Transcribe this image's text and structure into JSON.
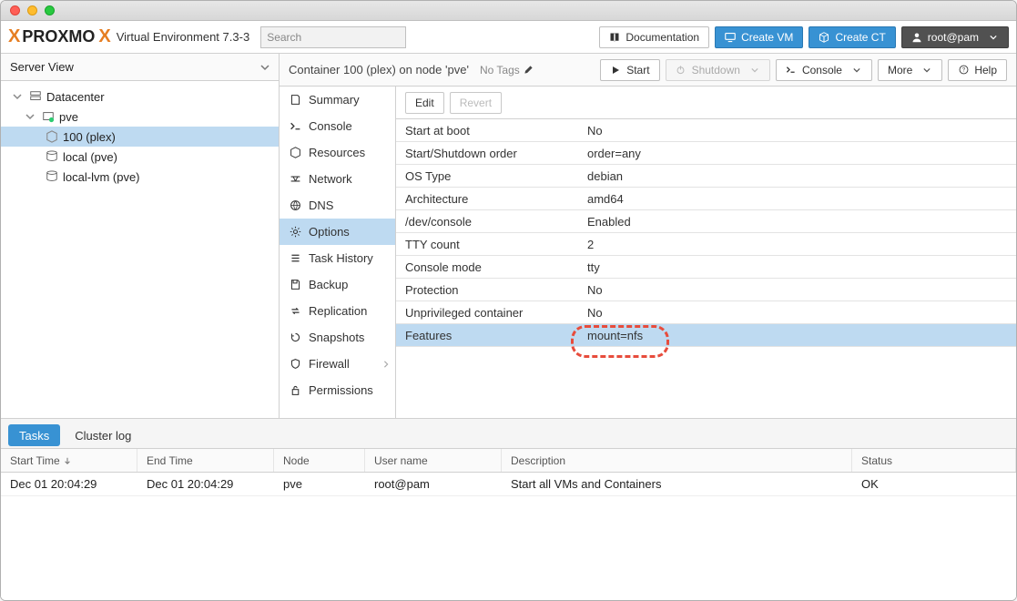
{
  "app": {
    "title": "Virtual Environment",
    "version": "7.3-3"
  },
  "header": {
    "search_placeholder": "Search",
    "documentation": "Documentation",
    "create_vm": "Create VM",
    "create_ct": "Create CT",
    "user": "root@pam"
  },
  "viewSelector": "Server View",
  "tree": {
    "datacenter": "Datacenter",
    "node": "pve",
    "container": "100 (plex)",
    "storage_local": "local (pve)",
    "storage_local_lvm": "local-lvm (pve)"
  },
  "breadcrumb": {
    "title": "Container 100 (plex) on node 'pve'",
    "tags": "No Tags",
    "actions": {
      "start": "Start",
      "shutdown": "Shutdown",
      "console": "Console",
      "more": "More",
      "help": "Help"
    }
  },
  "sidebar": {
    "summary": "Summary",
    "console": "Console",
    "resources": "Resources",
    "network": "Network",
    "dns": "DNS",
    "options": "Options",
    "task_history": "Task History",
    "backup": "Backup",
    "replication": "Replication",
    "snapshots": "Snapshots",
    "firewall": "Firewall",
    "permissions": "Permissions"
  },
  "options_toolbar": {
    "edit": "Edit",
    "revert": "Revert"
  },
  "options": [
    {
      "k": "Start at boot",
      "v": "No"
    },
    {
      "k": "Start/Shutdown order",
      "v": "order=any"
    },
    {
      "k": "OS Type",
      "v": "debian"
    },
    {
      "k": "Architecture",
      "v": "amd64"
    },
    {
      "k": "/dev/console",
      "v": "Enabled"
    },
    {
      "k": "TTY count",
      "v": "2"
    },
    {
      "k": "Console mode",
      "v": "tty"
    },
    {
      "k": "Protection",
      "v": "No"
    },
    {
      "k": "Unprivileged container",
      "v": "No"
    },
    {
      "k": "Features",
      "v": "mount=nfs",
      "selected": true,
      "highlight": true
    }
  ],
  "bottom": {
    "tabs": {
      "tasks": "Tasks",
      "cluster_log": "Cluster log"
    },
    "columns": {
      "start": "Start Time",
      "end": "End Time",
      "node": "Node",
      "user": "User name",
      "desc": "Description",
      "status": "Status"
    },
    "rows": [
      {
        "start": "Dec 01 20:04:29",
        "end": "Dec 01 20:04:29",
        "node": "pve",
        "user": "root@pam",
        "desc": "Start all VMs and Containers",
        "status": "OK"
      }
    ]
  }
}
